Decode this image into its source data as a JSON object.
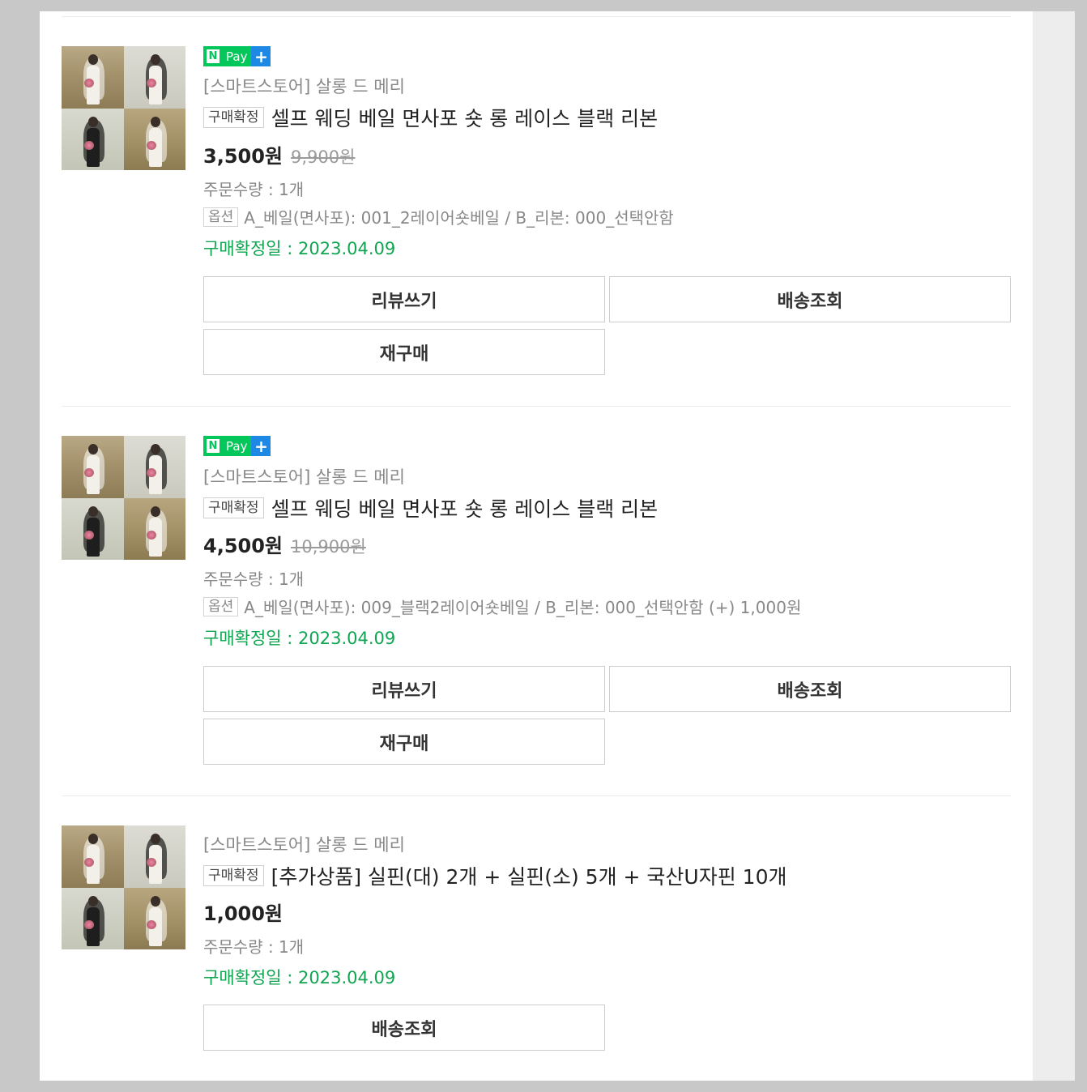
{
  "items": [
    {
      "has_npay": true,
      "npay_label": "Pay",
      "store": "[스마트스토어] 살롱 드 메리",
      "badge": "구매확정",
      "title": "셀프 웨딩 베일 면사포 숏 롱 레이스 블랙 리본",
      "price": "3,500원",
      "original_price": "9,900원",
      "quantity": "주문수량 : 1개",
      "option_label": "옵션",
      "option": "A_베일(면사포): 001_2레이어숏베일 / B_리본: 000_선택안함",
      "confirm_date": "구매확정일 : 2023.04.09",
      "buttons": [
        "리뷰쓰기",
        "배송조회",
        "재구매"
      ]
    },
    {
      "has_npay": true,
      "npay_label": "Pay",
      "store": "[스마트스토어] 살롱 드 메리",
      "badge": "구매확정",
      "title": "셀프 웨딩 베일 면사포 숏 롱 레이스 블랙 리본",
      "price": "4,500원",
      "original_price": "10,900원",
      "quantity": "주문수량 : 1개",
      "option_label": "옵션",
      "option": "A_베일(면사포): 009_블랙2레이어숏베일 / B_리본: 000_선택안함 (+) 1,000원",
      "confirm_date": "구매확정일 : 2023.04.09",
      "buttons": [
        "리뷰쓰기",
        "배송조회",
        "재구매"
      ]
    },
    {
      "has_npay": false,
      "store": "[스마트스토어] 살롱 드 메리",
      "badge": "구매확정",
      "title": "[추가상품] 실핀(대) 2개 + 실핀(소) 5개 + 국산U자핀 10개",
      "price": "1,000원",
      "quantity": "주문수량 : 1개",
      "confirm_date": "구매확정일 : 2023.04.09",
      "buttons": [
        "배송조회"
      ]
    }
  ],
  "colors": {
    "npay_green": "#03c75a",
    "npay_blue": "#1e88e5",
    "confirm_green": "#10a551"
  }
}
